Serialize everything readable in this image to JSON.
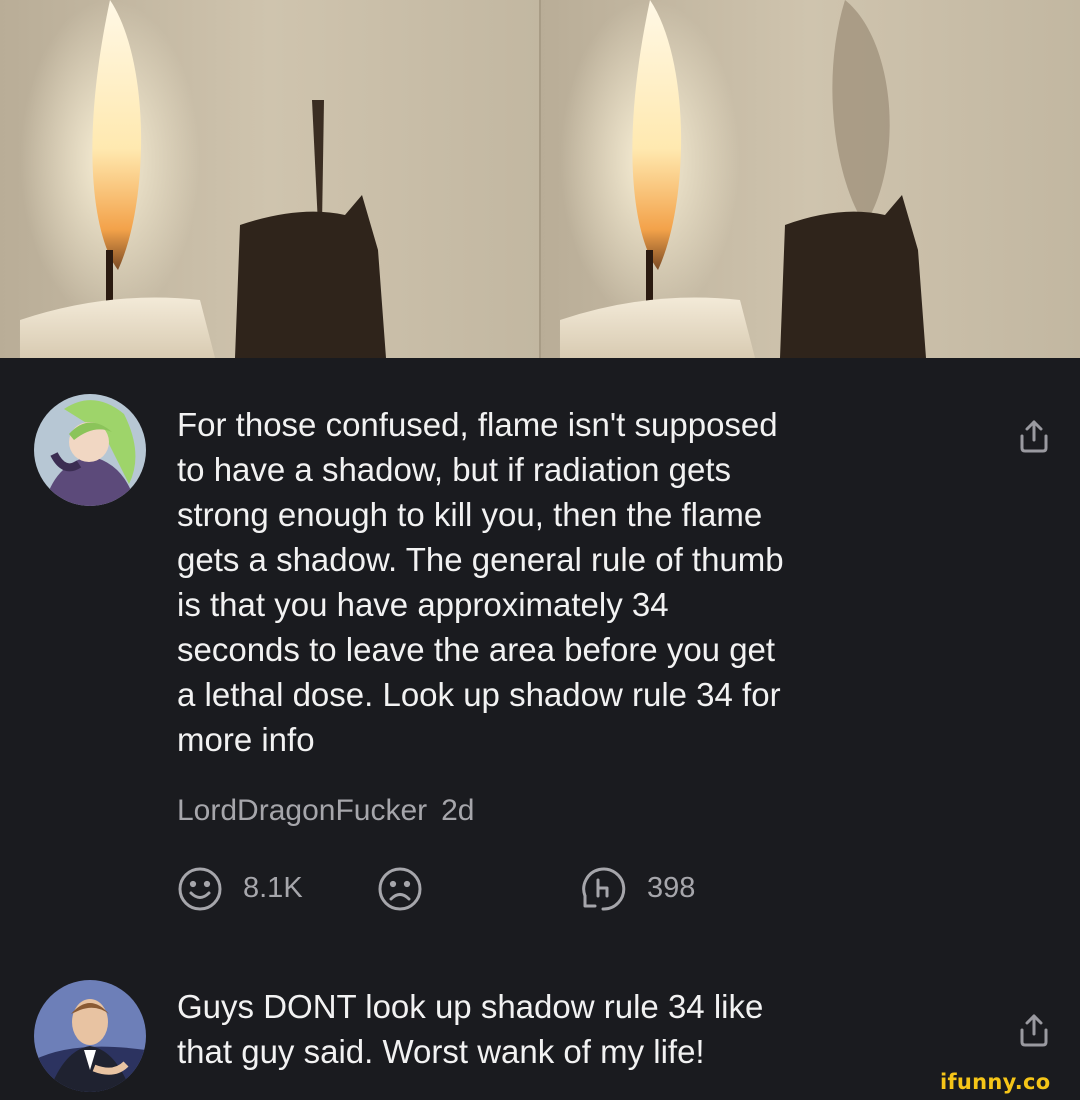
{
  "image": {
    "description": "Two candle photos side by side showing flame and shadow"
  },
  "comments": [
    {
      "text": "For those confused, flame isn't supposed\nto have a shadow, but if radiation gets\nstrong enough to kill you, then the flame\ngets a shadow. The general rule of thumb\nis that you have approximately 34\nseconds to leave the area before you get\na lethal dose. Look up shadow rule 34 for\nmore info",
      "username": "LordDragonFucker",
      "time": "2d",
      "likes": "8.1K",
      "replies": "398"
    },
    {
      "text": "Guys DONT look up shadow rule 34 like\nthat guy said. Worst wank of my life!"
    }
  ],
  "watermark": "ifunny.co",
  "colors": {
    "background": "#1a1b1f",
    "text": "#f2f2f2",
    "meta": "#a6a6ab",
    "watermark": "#f5c518"
  }
}
